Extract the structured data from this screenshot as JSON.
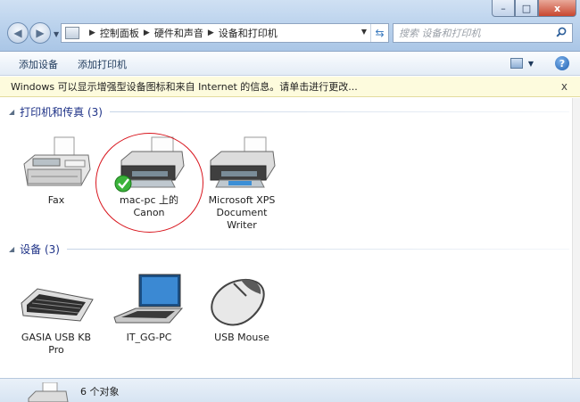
{
  "window": {
    "min": "–",
    "max": "□",
    "close": "x"
  },
  "breadcrumb": [
    "控制面板",
    "硬件和声音",
    "设备和打印机"
  ],
  "search": {
    "placeholder": "搜索 设备和打印机"
  },
  "toolbar": {
    "add_device": "添加设备",
    "add_printer": "添加打印机"
  },
  "infobar": {
    "text": "Windows 可以显示增强型设备图标和来自 Internet 的信息。请单击进行更改...",
    "close": "x"
  },
  "groups": {
    "printers": {
      "title": "打印机和传真 (3)"
    },
    "devices": {
      "title": "设备 (3)"
    }
  },
  "printers": [
    {
      "label_lines": [
        "Fax"
      ],
      "icon": "fax-icon"
    },
    {
      "label_lines": [
        "mac-pc 上的",
        "Canon"
      ],
      "icon": "printer-icon",
      "default": true
    },
    {
      "label_lines": [
        "Microsoft XPS",
        "Document",
        "Writer"
      ],
      "icon": "printer-icon"
    }
  ],
  "devices": [
    {
      "label_lines": [
        "GASIA USB KB",
        "Pro"
      ],
      "icon": "keyboard-icon"
    },
    {
      "label_lines": [
        "IT_GG-PC"
      ],
      "icon": "laptop-icon"
    },
    {
      "label_lines": [
        "USB Mouse"
      ],
      "icon": "mouse-icon"
    }
  ],
  "status": {
    "text": "6 个对象"
  },
  "colors": {
    "highlight_circle": "#d8141c",
    "group_title": "#1e3287",
    "infobar_bg": "#fdfbdd"
  }
}
